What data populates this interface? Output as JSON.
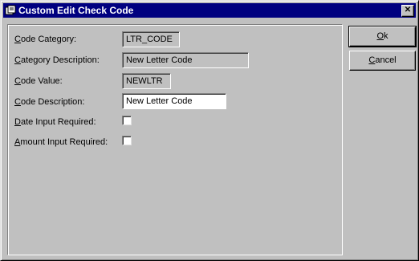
{
  "window": {
    "title": "Custom Edit Check Code",
    "close_glyph": "✕"
  },
  "form": {
    "code_category": {
      "label_mn": "C",
      "label_rest": "ode Category:",
      "value": "LTR_CODE"
    },
    "category_description": {
      "label_mn": "C",
      "label_rest": "ategory Description:",
      "value": "New Letter Code"
    },
    "code_value": {
      "label_mn": "C",
      "label_rest": "ode Value:",
      "value": "NEWLTR"
    },
    "code_description": {
      "label_mn": "C",
      "label_rest": "ode Description:",
      "value": "New Letter Code"
    },
    "date_input_required": {
      "label_mn": "D",
      "label_rest": "ate Input Required:",
      "checked": false
    },
    "amount_input_required": {
      "label_mn": "A",
      "label_rest": "mount Input Required:",
      "checked": false
    }
  },
  "buttons": {
    "ok": {
      "mn": "O",
      "rest": "k"
    },
    "cancel": {
      "mn": "C",
      "rest": "ancel"
    }
  }
}
